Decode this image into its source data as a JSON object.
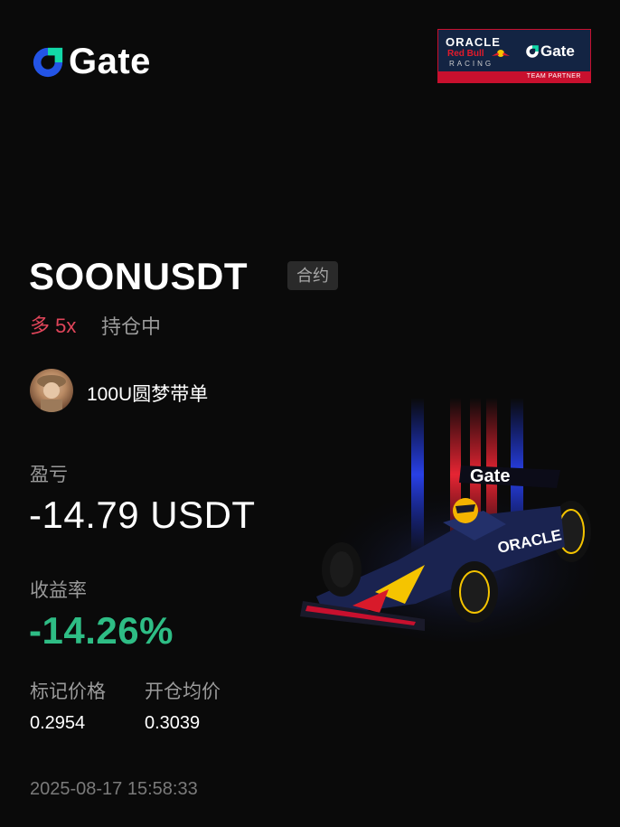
{
  "brand": {
    "logo_text": "Gate",
    "logo_icon": "gate-logo-icon",
    "accent": "#2354e6",
    "logo_mark_color": "#12d8a8"
  },
  "partner_badge": {
    "line1": "ORACLE",
    "line2": "Red Bull",
    "line3": "RACING",
    "gate_text": "Gate",
    "footer": "TEAM PARTNER"
  },
  "position": {
    "pair": "SOONUSDT",
    "contract_tag": "合约",
    "side": "多 5x",
    "status": "持仓中"
  },
  "trader": {
    "name": "100U圆梦带单",
    "avatar_icon": "avatar-icon"
  },
  "pnl": {
    "label": "盈亏",
    "value": "-14.79 USDT"
  },
  "return_rate": {
    "label": "收益率",
    "value": "-14.26%"
  },
  "prices": {
    "mark_label": "标记价格",
    "mark_value": "0.2954",
    "open_label": "开仓均价",
    "open_value": "0.3039"
  },
  "timestamp": "2025-08-17 15:58:33",
  "colors": {
    "long": "#e0455a",
    "negative_return": "#2ebd85",
    "muted": "#9a9a9a",
    "background": "#0a0a0a"
  },
  "car_image": {
    "livery_text": "Gate",
    "sponsor_text": "ORACLE"
  }
}
